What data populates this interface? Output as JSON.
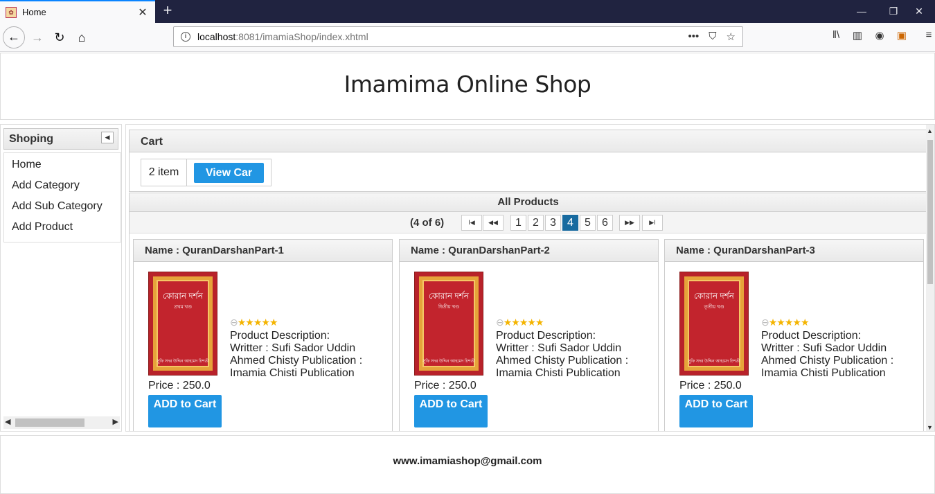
{
  "browser": {
    "tab_title": "Home",
    "tab_close": "✕",
    "new_tab": "+",
    "url_host": "localhost",
    "url_path": ":8081/imamiaShop/index.xhtml",
    "url_more": "•••"
  },
  "header": {
    "title": "Imamima Online Shop"
  },
  "sidebar": {
    "title": "Shoping",
    "items": [
      {
        "label": "Home"
      },
      {
        "label": "Add Category"
      },
      {
        "label": "Add Sub Category"
      },
      {
        "label": "Add Product"
      }
    ]
  },
  "cart": {
    "title": "Cart",
    "count": "2 item",
    "view_button": "View Car"
  },
  "products": {
    "title": "All Products",
    "pager_info": "(4 of 6)",
    "pages": [
      "1",
      "2",
      "3",
      "4",
      "5",
      "6"
    ],
    "active_page": "4",
    "items": [
      {
        "name": "Name : QuranDarshanPart-1",
        "book_title": "কোরান দর্শন",
        "book_sub": "প্রথম খণ্ড",
        "book_author": "সুফি সদর উদ্দিন আহমেদ চিশতী",
        "rating": 5,
        "description": "Product Description:",
        "details": "Writter : Sufi Sador Uddin Ahmed Chisty Publication : Imamia Chisti Publication",
        "price": "Price : 250.0",
        "add_button": "ADD to Cart"
      },
      {
        "name": "Name : QuranDarshanPart-2",
        "book_title": "কোরান দর্শন",
        "book_sub": "দ্বিতীয় খণ্ড",
        "book_author": "সুফি সদর উদ্দিন আহমেদ চিশতী",
        "rating": 5,
        "description": "Product Description:",
        "details": "Writter : Sufi Sador Uddin Ahmed Chisty Publication : Imamia Chisti Publication",
        "price": "Price : 250.0",
        "add_button": "ADD to Cart"
      },
      {
        "name": "Name : QuranDarshanPart-3",
        "book_title": "কোরান দর্শন",
        "book_sub": "তৃতীয় খণ্ড",
        "book_author": "সুফি সদর উদ্দিন আহমেদ চিশতী",
        "rating": 5,
        "description": "Product Description:",
        "details": "Writter : Sufi Sador Uddin Ahmed Chisty Publication : Imamia Chisti Publication",
        "price": "Price : 250.0",
        "add_button": "ADD to Cart"
      }
    ]
  },
  "footer": {
    "email": "www.imamiashop@gmail.com"
  },
  "colors": {
    "accent": "#2196e3",
    "active_page": "#186ba0",
    "titlebar": "#202340",
    "book_cover": "#b8222a"
  }
}
